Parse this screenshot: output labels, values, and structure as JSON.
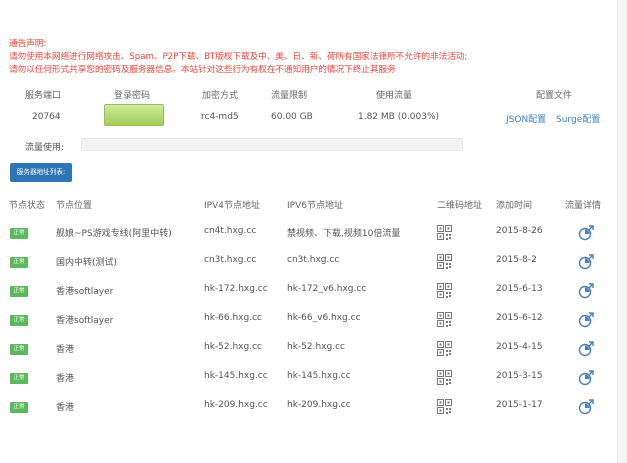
{
  "notice": {
    "title": "通告声明:",
    "line1": "请勿使用本网络进行网络攻击、Spam、P2P下载、BT版权下载及中、美、日、新、荷所有国家法律所不允许的非法活动;",
    "line2": "请勿以任何形式共享您的密码及服务器信息。本站针对这些行为有权在不通知用户的情况下终止其服务"
  },
  "service": {
    "headers": {
      "port": "服务端口",
      "password": "登录密码",
      "method": "加密方式",
      "limit": "流量限制",
      "used": "使用流量",
      "config": "配置文件"
    },
    "port": "20764",
    "method": "rc4-md5",
    "limit": "60.00 GB",
    "used": "1.82 MB (0.003%)",
    "json_config": "JSON配置",
    "surge_config": "Surge配置",
    "usage_label": "流量使用:",
    "usage_fraction": 3e-05,
    "password_box_color": "#a9d760"
  },
  "list_button": "服务器地址列表:",
  "table": {
    "headers": {
      "status": "节点状态",
      "location": "节点位置",
      "ipv4": "IPV4节点地址",
      "ipv6": "IPV6节点地址",
      "qr": "二维码地址",
      "date": "添加时间",
      "traffic": "流量详情"
    },
    "status_color": "#5cb85c",
    "rows": [
      {
        "status": "正常",
        "location": "舰娘~PS游戏专线(阿里中转)",
        "ipv4": "cn4t.hxg.cc",
        "ipv6": "禁视频、下载,视频10倍流量",
        "date": "2015-8-26"
      },
      {
        "status": "正常",
        "location": "国内中转(测试)",
        "ipv4": "cn3t.hxg.cc",
        "ipv6": "cn3t.hxg.cc",
        "date": "2015-8-2"
      },
      {
        "status": "正常",
        "location": "香港softlayer",
        "ipv4": "hk-172.hxg.cc",
        "ipv6": "hk-172_v6.hxg.cc",
        "date": "2015-6-13"
      },
      {
        "status": "正常",
        "location": "香港softlayer",
        "ipv4": "hk-66.hxg.cc",
        "ipv6": "hk-66_v6.hxg.cc",
        "date": "2015-6-12"
      },
      {
        "status": "正常",
        "location": "香港",
        "ipv4": "hk-52.hxg.cc",
        "ipv6": "hk-52.hxg.cc",
        "date": "2015-4-15"
      },
      {
        "status": "正常",
        "location": "香港",
        "ipv4": "hk-145.hxg.cc",
        "ipv6": "hk-145.hxg.cc",
        "date": "2015-3-15"
      },
      {
        "status": "正常",
        "location": "香港",
        "ipv4": "hk-209.hxg.cc",
        "ipv6": "hk-209.hxg.cc",
        "date": "2015-1-17"
      }
    ]
  },
  "icons": {
    "qr": "qr-code-icon",
    "traffic": "traffic-chart-icon"
  }
}
